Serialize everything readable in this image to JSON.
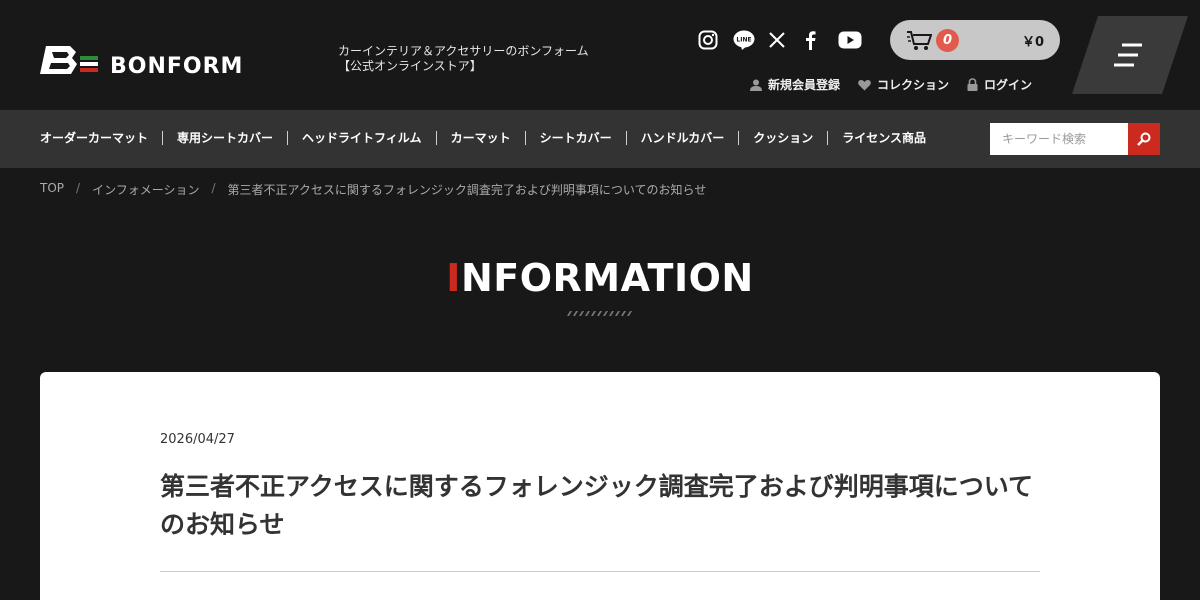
{
  "brand": {
    "name": "BONFORM",
    "tagline": "カーインテリア＆アクセサリーのボンフォーム\n【公式オンラインストア】",
    "accent_color": "#cc2a1e"
  },
  "social": [
    "instagram-icon",
    "line-icon",
    "x-icon",
    "facebook-icon",
    "youtube-icon"
  ],
  "cart": {
    "count": "0",
    "total": "￥0"
  },
  "account": {
    "register": "新規会員登録",
    "collection": "コレクション",
    "login": "ログイン"
  },
  "nav": {
    "items": [
      "オーダーカーマット",
      "専用シートカバー",
      "ヘッドライトフィルム",
      "カーマット",
      "シートカバー",
      "ハンドルカバー",
      "クッション",
      "ライセンス商品"
    ]
  },
  "search": {
    "placeholder": "キーワード検索"
  },
  "breadcrumb": {
    "items": [
      "TOP",
      "インフォメーション",
      "第三者不正アクセスに関するフォレンジック調査完了および判明事項についてのお知らせ"
    ],
    "separator": "/"
  },
  "section": {
    "title_accent": "I",
    "title_rest": "NFORMATION"
  },
  "post": {
    "date": "2026/04/27",
    "title": "第三者不正アクセスに関するフォレンジック調査完了および判明事項についてのお知らせ"
  }
}
